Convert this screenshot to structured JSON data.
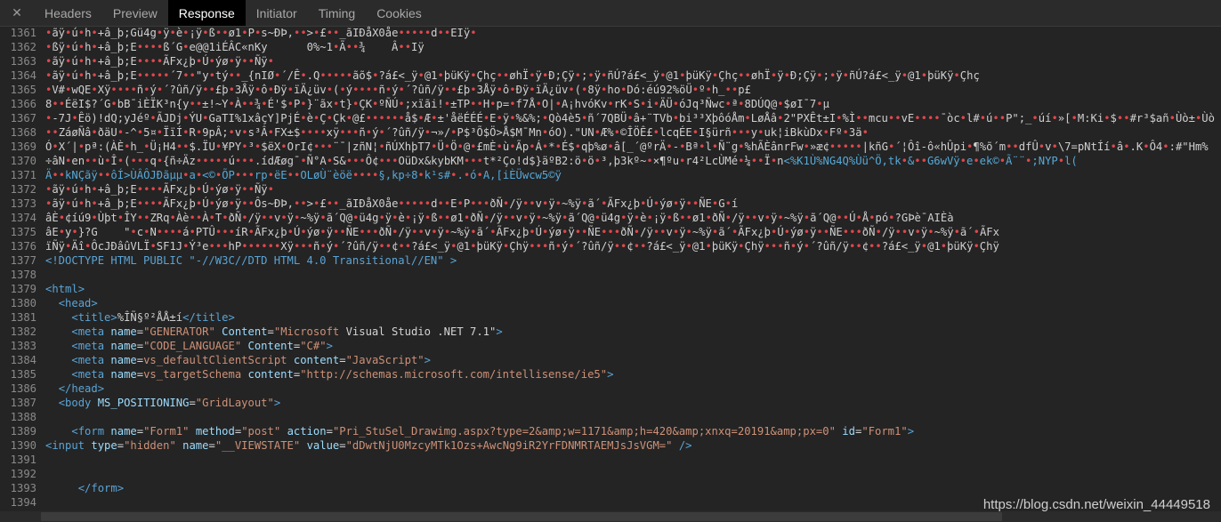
{
  "tabs": {
    "close_label": "✕",
    "items": [
      "Headers",
      "Preview",
      "Response",
      "Initiator",
      "Timing",
      "Cookies"
    ],
    "active": "Response"
  },
  "lines": [
    {
      "n": "1361",
      "text": "•ãÿ•ú•h•+â_þ;Gü4g•ÿ•è•¡ÿ•ß••ø1•P•s~ÐÞ,••>•£••_ãIÐåX0åe•••••d••EIÿ•",
      "kind": "garbage"
    },
    {
      "n": "1362",
      "text": "•ßÿ•ú•h•+â_þ;E••••ß´G•e@@1iÉÂC«nKy      0%~1•Ã••¾    Â••Iÿ",
      "kind": "garbage"
    },
    {
      "n": "1363",
      "text": "•ãÿ•ú•h•+â_þ;E••••ÃFx¿þ•Ú•ýø•ÿ••Ñÿ•",
      "kind": "garbage"
    },
    {
      "n": "1364",
      "text": "•ãÿ•ú•h•+â_þ;E•••••´7••\"y•tý••_{nIØ•´/Ê•.Q•••••ãõ$•?á£<_ÿ•@1•þüKÿ•Çhç••øhÏ•ÿ•Ð;Çÿ•;•ÿ•ñÚ?á£<_ÿ•@1•þüKÿ•Çhç••øhÏ•ÿ•Ð;Çÿ•;•ÿ•ñÚ?á£<_ÿ•@1•þüKÿ•Çhç",
      "kind": "garbage"
    },
    {
      "n": "1365",
      "text": "•V#•wQE•Xÿ••••ñ•ý•´?ûñ/ÿ••£þ•3Åÿ•ô•Ðÿ•ïÄ¿üv•(•ý••••ñ•ý•´?ûñ/ÿ••£þ•3Åÿ•ô•Ðÿ•ïÄ¿üv•(•8ÿ•ho•Dó:éú92%öÜ•º•h_••p£",
      "kind": "garbage"
    },
    {
      "n": "1366",
      "text": "8••ÉëI$?´G•bB¯iÈÏK³n{y••±!~Y•À••¾•É'$•P•}¨ãx•t}•ÇK•ºÑÚ•;xïãi!•±TP••H•p=•f7Å•O|•A¡hvóKv•rK•S•i•ÄÜ•óJq³Ñwc•ª•8DÚQ@•$øI¯7•µ",
      "kind": "garbage"
    },
    {
      "n": "1367",
      "text": "•-7J•Êö)!dQ;yJéº•ÃJDj•ÝU•GaTI%1xâçY]PjÉ•è•Ç•Çk•@£••••••å$•Æ•±'åëÉÉÉ•E•ÿ•%&%;•Qò4è5•ñ´7QBÜ•â+¨TVb•bi³³XþôóÅm•LøÅâ•2\"PXÊt±I•%Ì••mcu••vE••••¯òc•l#•ú••P\";_•úí•»[•M:Ki•$••#r³$añ•Ùò±•Ùò",
      "kind": "garbage"
    },
    {
      "n": "1368",
      "text": "••ZáøÑâ•ðäU•-^•5¤•ÏïÍ•R•9pÂ;•v•s³Â•FX±$••••xÿ•••ñ•ý•´?ûñ/ÿ•¬»/•P$³Õ$Ö>Å$M¯Mn•óO).\"UN•Æ%•©ÎÖÊ£•lcqÉE•I§ürñ•••y•uk¦iBkùDx•Fº•3ä•",
      "kind": "garbage"
    },
    {
      "n": "1369",
      "text": "Ó•X´|•pª:(ÀÈ•h_•Ü¡H4••$.ÏU•¥PY•³•$ëX•OrI¢•••¨¯|zñN¦•ñÚXhþT7•Ü•Ö•@•£mÈ•ù•Ãp•Á•*•É$•qþ%ø•â[_´@ºrÄ•-•Bª•l•Ñ¨g•%hÃÈânrFw•»æ¢•••••|kñG•´¦Ôî-ô«hÛpi•¶%õ´m••dfÛ•v•\\7=pNtÍí•â•.K•Ô4•:#\"Hm%",
      "kind": "garbage"
    },
    {
      "n": "1370",
      "text": "÷âN•en••ù•Î•(•••q•{ñ÷Äz•••••ú•••.ídÆøg¯•Ñ°A•S&•••Ô¢•••OüDx&kybKM•••t*²Ço!d$}äºB2:ö•ö•³,þ3kº~•×¶ºu•r4²LcÙMé•¼••Ï•n<%K1Ù%NG4Q%Ùü^Ö,tk•&••G6wVÿ•e•ek©•Ã¨¨•;NYP•l(",
      "kind": "mixed"
    },
    {
      "n": "1371",
      "text": "Ä••kNÇãÿ••ôÍ>ÙÂÔJÐãµµ•a•<©•ÕP•••rp•ëE••OLøÙ¨èöë••••§,kp÷8•k¹s#•.•ó•A,[iÈÜwcw5©ÿ",
      "kind": "cyan"
    },
    {
      "n": "1372",
      "text": "•ãÿ•ú•h•+â_þ;E••••ÃFx¿þ•Ú•ýø•ÿ••Ñÿ•",
      "kind": "garbage"
    },
    {
      "n": "1373",
      "text": "•ãÿ•ú•h•+â_þ;E••••ÃFx¿þ•Ú•ýø•ÿ••Ôs~ÐÞ,••>•£••_ãIÐåX0åe•••••d••E•P•••ðÑ•/ÿ••v•ÿ•~%ÿ•ã´•ÃFx¿þ•Ú•ýø•ÿ••ÑE•G•í",
      "kind": "garbage"
    },
    {
      "n": "1374",
      "text": "âÈ•¢íú9•Ùþt•ÎY••ZRq•Àè••À•T•ðÑ•/ÿ••v•ÿ•~%ÿ•ã´Q@•ü4g•ÿ•è•¡ÿ•ß••ø1•ðÑ•/ÿ••v•ÿ•~%ÿ•ã´Q@•ü4g•ÿ•è•¡ÿ•ß••ø1•ðÑ•/ÿ••v•ÿ•~%ÿ•ã´Q@••Ú•Å•pó•?GÞè¯AIÈà",
      "kind": "garbage"
    },
    {
      "n": "1375",
      "text": "âE•y•}?G    \"•c•N••••á•PTÛ•••íR•ÃFx¿þ•Ú•ýø•ÿ••ÑE•••ðÑ•/ÿ••v•ÿ•~%ÿ•ã´•ÃFx¿þ•Ú•ýø•ÿ••ÑE•••ðÑ•/ÿ••v•ÿ•~%ÿ•ã´•ÃFx¿þ•Ú•ýø•ÿ••ÑE•••ðÑ•/ÿ••v•ÿ•~%ÿ•ã´•ÃFx",
      "kind": "garbage"
    },
    {
      "n": "1376",
      "text": "ïÑÿ•Äî•ÔcJÐâûVLÏ•SF1J•Ý³e•••hP••••••Xÿ•••ñ•ý•´?ûñ/ÿ••¢••?á£<_ÿ•@1•þüKÿ•Çhÿ•••ñ•ý•´?ûñ/ÿ••¢••?á£<_ÿ•@1•þüKÿ•Çhÿ•••ñ•ý•´?ûñ/ÿ••¢••?á£<_ÿ•@1•þüKÿ•Çhÿ",
      "kind": "garbage"
    },
    {
      "n": "1377",
      "text": "<!DOCTYPE HTML PUBLIC \"-//W3C//DTD HTML 4.0 Transitional//EN\" >",
      "kind": "doctype"
    },
    {
      "n": "1378",
      "text": "",
      "kind": "blank"
    },
    {
      "n": "1379",
      "text": "<html>",
      "kind": "html"
    },
    {
      "n": "1380",
      "text": "  <head>",
      "kind": "html"
    },
    {
      "n": "1381",
      "text": "    <title>%ÎÑ§º²ÅÅ±í</title>",
      "kind": "html"
    },
    {
      "n": "1382",
      "text": "    <meta name=\"GENERATOR\" Content=\"Microsoft Visual Studio .NET 7.1\">",
      "kind": "html"
    },
    {
      "n": "1383",
      "text": "    <meta name=\"CODE_LANGUAGE\" Content=\"C#\">",
      "kind": "html"
    },
    {
      "n": "1384",
      "text": "    <meta name=vs_defaultClientScript content=\"JavaScript\">",
      "kind": "html"
    },
    {
      "n": "1385",
      "text": "    <meta name=vs_targetSchema content=\"http://schemas.microsoft.com/intellisense/ie5\">",
      "kind": "html"
    },
    {
      "n": "1386",
      "text": "  </head>",
      "kind": "html"
    },
    {
      "n": "1387",
      "text": "  <body MS_POSITIONING=\"GridLayout\">",
      "kind": "html"
    },
    {
      "n": "1388",
      "text": "",
      "kind": "blank"
    },
    {
      "n": "1389",
      "text": "    <form name=\"Form1\" method=\"post\" action=\"Pri_StuSel_Drawimg.aspx?type=2&amp;w=1171&amp;h=420&amp;xnxq=20191&amp;px=0\" id=\"Form1\">",
      "kind": "html"
    },
    {
      "n": "1390",
      "text": "<input type=\"hidden\" name=\"__VIEWSTATE\" value=\"dDwtNjU0MzcyMTk1Ozs+AwcNg9iR2YrFDNMRTAEMJsJsVGM=\" />",
      "kind": "html"
    },
    {
      "n": "1391",
      "text": "",
      "kind": "blank"
    },
    {
      "n": "1392",
      "text": "",
      "kind": "blank"
    },
    {
      "n": "1393",
      "text": "     </form>",
      "kind": "html"
    },
    {
      "n": "1394",
      "text": "",
      "kind": "blank"
    }
  ],
  "watermark": "https://blog.csdn.net/weixin_44449518",
  "colors": {
    "background": "#242424",
    "tab_active_bg": "#000000",
    "tag": "#5aa4d6",
    "attribute": "#9cdcfe",
    "string": "#ce9178",
    "replacement_dot": "#e0474c"
  }
}
